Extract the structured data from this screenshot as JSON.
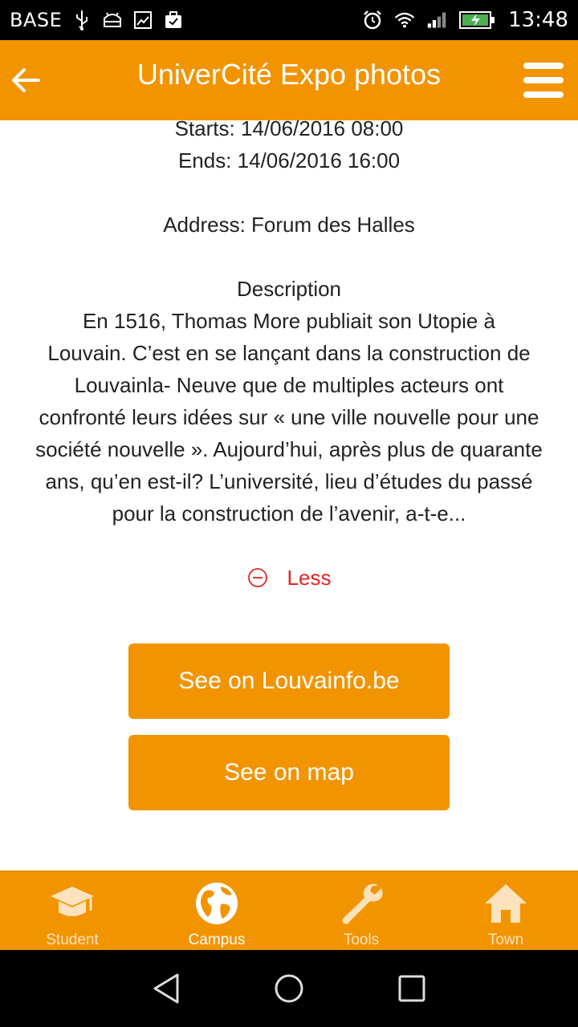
{
  "status_bar": {
    "carrier": "BASE",
    "time": "13:48",
    "left_icons": [
      "usb-icon",
      "android-icon",
      "image-icon",
      "bag-check-icon"
    ],
    "right_icons": [
      "alarm-icon",
      "wifi-icon",
      "signal-icon",
      "battery-charging-icon"
    ]
  },
  "header": {
    "title": "UniverCité Expo photos",
    "back_icon": "arrow-left-icon",
    "menu_icon": "hamburger-menu-icon"
  },
  "event": {
    "starts": "Starts: 14/06/2016 08:00",
    "ends": "Ends: 14/06/2016 16:00",
    "address": "Address: Forum des Halles",
    "description_heading": "Description",
    "description_lines": [
      "En 1516, Thomas More publiait son Utopie à",
      "Louvain. C’est en se lançant dans la construction de",
      "Louvainla- Neuve que de multiples acteurs ont",
      "confronté leurs idées sur « une ville nouvelle pour une",
      "société nouvelle ». Aujourd’hui, après plus de quarante",
      "ans, qu’en est-il? L’université, lieu d’études du passé",
      "pour la construction de l’avenir, a-t-e..."
    ],
    "less_label": "Less"
  },
  "buttons": {
    "louvainfo": "See on Louvainfo.be",
    "map": "See on map"
  },
  "bottom_nav": {
    "items": [
      {
        "label": "Student",
        "icon": "graduation-cap-icon",
        "active": false
      },
      {
        "label": "Campus",
        "icon": "globe-icon",
        "active": true
      },
      {
        "label": "Tools",
        "icon": "wrench-icon",
        "active": false
      },
      {
        "label": "Town",
        "icon": "home-icon",
        "active": false
      }
    ]
  },
  "colors": {
    "accent": "#f29400",
    "less_red": "#e52521",
    "text": "#222222"
  }
}
